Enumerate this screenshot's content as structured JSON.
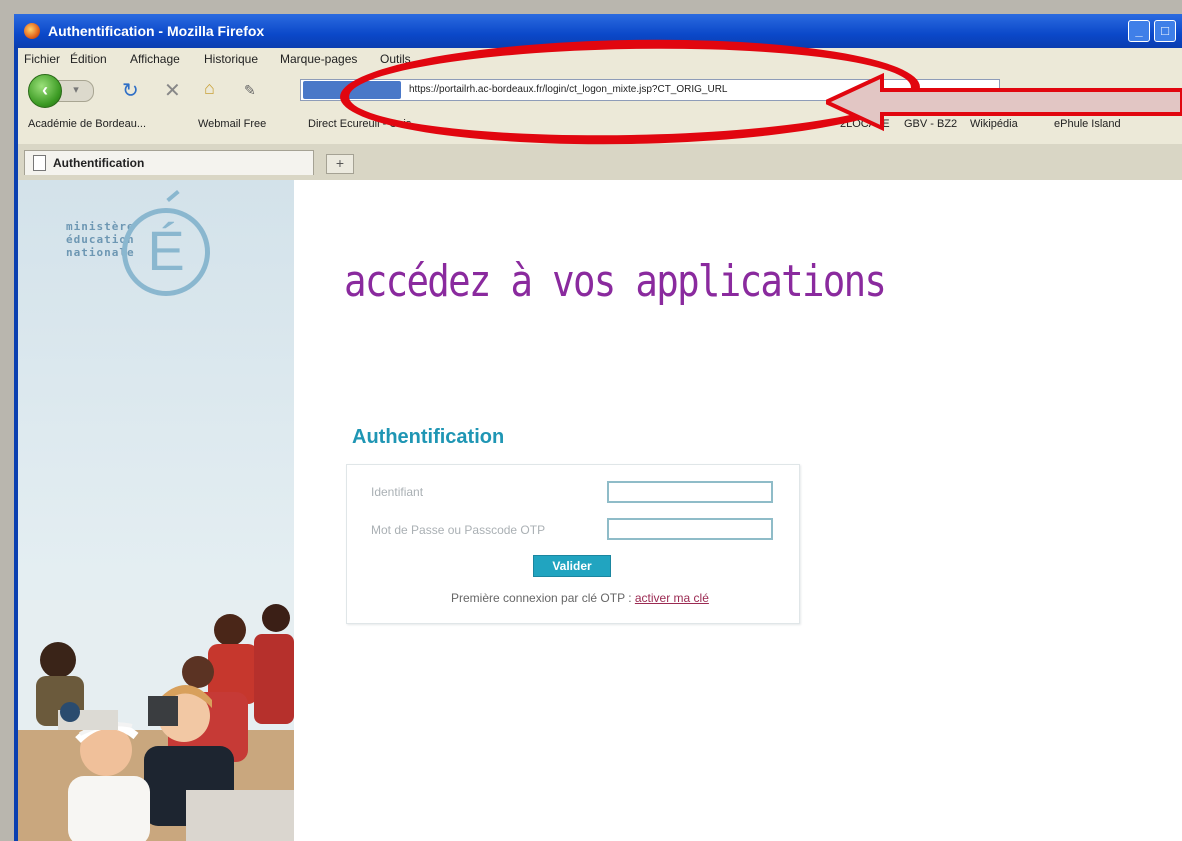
{
  "window": {
    "title": "Authentification - Mozilla Firefox"
  },
  "menubar": [
    "Fichier",
    "Édition",
    "Affichage",
    "Historique",
    "Marque-pages",
    "Outils"
  ],
  "address_bar": {
    "url": "https://portailrh.ac-bordeaux.fr/login/ct_logon_mixte.jsp?CT_ORIG_URL"
  },
  "bookmarks": [
    "Académie de Bordeau...",
    "Webmail Free",
    "Direct Ecureuil - Cais",
    "2LOCALE",
    "GBV - BZ2",
    "Wikipédia",
    "ePhule Island"
  ],
  "tab": {
    "label": "Authentification",
    "new_tab": "+"
  },
  "logo": {
    "lines": [
      "ministère",
      "éducation",
      "nationale"
    ],
    "letter": "É"
  },
  "page": {
    "headline": "accédez à vos applications",
    "auth_title": "Authentification",
    "identifiant_label": "Identifiant",
    "password_label": "Mot de Passe ou Passcode OTP",
    "submit_label": "Valider",
    "otp_text": "Première connexion par clé OTP :",
    "otp_link": "activer ma clé"
  },
  "colors": {
    "headline": "#8a2a9e",
    "accent": "#1f96b4",
    "highlight": "#e1060f"
  }
}
